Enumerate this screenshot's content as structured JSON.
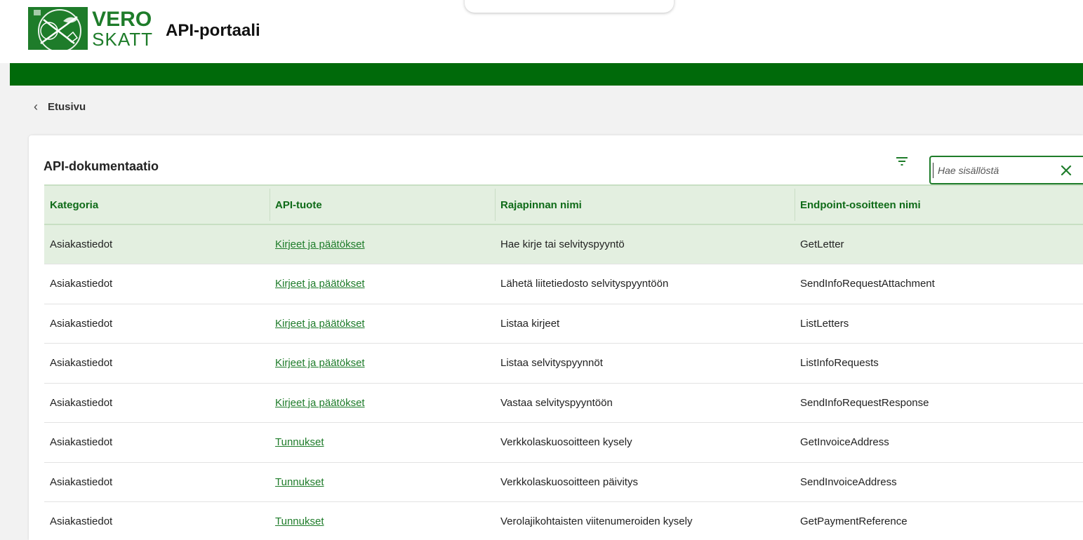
{
  "header": {
    "logo_line1": "VERO",
    "logo_line2": "SKATT",
    "portal_title": "API-portaali"
  },
  "breadcrumb": {
    "label": "Etusivu"
  },
  "card": {
    "title": "API-dokumentaatio",
    "search_placeholder": "Hae sisällöstä"
  },
  "table": {
    "columns": [
      "Kategoria",
      "API-tuote",
      "Rajapinnan nimi",
      "Endpoint-osoitteen nimi"
    ],
    "rows": [
      {
        "category": "Asiakastiedot",
        "product": "Kirjeet ja päätökset",
        "interface": "Hae kirje tai selvityspyyntö",
        "endpoint": "GetLetter"
      },
      {
        "category": "Asiakastiedot",
        "product": "Kirjeet ja päätökset",
        "interface": "Lähetä liitetiedosto selvityspyyntöön",
        "endpoint": "SendInfoRequestAttachment"
      },
      {
        "category": "Asiakastiedot",
        "product": "Kirjeet ja päätökset",
        "interface": "Listaa kirjeet",
        "endpoint": "ListLetters"
      },
      {
        "category": "Asiakastiedot",
        "product": "Kirjeet ja päätökset",
        "interface": "Listaa selvityspyynnöt",
        "endpoint": "ListInfoRequests"
      },
      {
        "category": "Asiakastiedot",
        "product": "Kirjeet ja päätökset",
        "interface": "Vastaa selvityspyyntöön",
        "endpoint": "SendInfoRequestResponse"
      },
      {
        "category": "Asiakastiedot",
        "product": "Tunnukset",
        "interface": "Verkkolaskuosoitteen kysely",
        "endpoint": "GetInvoiceAddress"
      },
      {
        "category": "Asiakastiedot",
        "product": "Tunnukset",
        "interface": "Verkkolaskuosoitteen päivitys",
        "endpoint": "SendInvoiceAddress"
      },
      {
        "category": "Asiakastiedot",
        "product": "Tunnukset",
        "interface": "Verolajikohtaisten viitenumeroiden kysely",
        "endpoint": "GetPaymentReference"
      }
    ]
  },
  "colors": {
    "brand_green": "#1e7c2a",
    "bar_green": "#006a0a",
    "header_row_bg": "#e3efe0"
  },
  "icons": {
    "filter": "filter-icon",
    "clear": "close-icon",
    "back": "chevron-left-icon"
  }
}
